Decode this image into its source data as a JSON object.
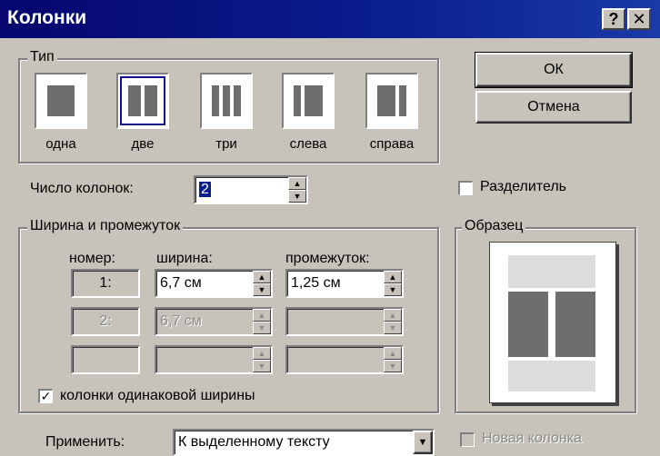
{
  "window": {
    "title": "Колонки",
    "help_glyph": "?",
    "close_glyph": "✕"
  },
  "type_group": {
    "title": "Тип",
    "presets": [
      {
        "label": "одна",
        "cols": 1
      },
      {
        "label": "две",
        "cols": 2,
        "selected": true
      },
      {
        "label": "три",
        "cols": 3
      },
      {
        "label": "слева",
        "cols": 2
      },
      {
        "label": "справа",
        "cols": 2
      }
    ]
  },
  "buttons": {
    "ok": "ОК",
    "cancel": "Отмена"
  },
  "num_columns": {
    "label": "Число колонок:",
    "value": "2"
  },
  "separator": {
    "label": "Разделитель",
    "checked": false
  },
  "width_group": {
    "title": "Ширина и промежуток",
    "headers": {
      "number": "номер:",
      "width": "ширина:",
      "spacing": "промежуток:"
    },
    "rows": [
      {
        "number": "1:",
        "width": "6,7 см",
        "spacing": "1,25 см"
      },
      {
        "number": "2:",
        "width": "6,7 см",
        "spacing": ""
      },
      {
        "number": "",
        "width": "",
        "spacing": ""
      }
    ],
    "equal_width": {
      "label": "колонки одинаковой ширины",
      "checked": true
    }
  },
  "preview": {
    "title": "Образец"
  },
  "apply": {
    "label": "Применить:",
    "value": "К выделенному тексту"
  },
  "new_column": {
    "label": "Новая колонка",
    "checked": false
  },
  "glyphs": {
    "check": "✓",
    "spin_up": "▲",
    "spin_down": "▼",
    "dropdown": "▼"
  }
}
